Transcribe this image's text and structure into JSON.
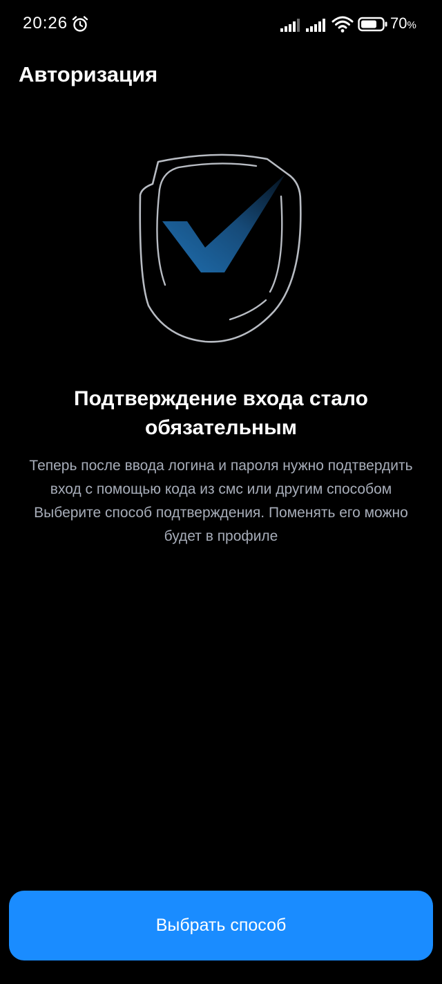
{
  "status_bar": {
    "time": "20:26",
    "battery_value": "70",
    "battery_unit": "%",
    "icons": [
      "alarm-icon",
      "signal-icon",
      "signal-icon",
      "wifi-icon",
      "battery-icon"
    ]
  },
  "header": {
    "title": "Авторизация"
  },
  "illustration": {
    "icon": "shield-check-icon",
    "accent_color": "#1f6fb0"
  },
  "content": {
    "headline": "Подтверждение входа стало обязательным",
    "description_1": "Теперь после ввода логина и пароля нужно подтвердить вход с помощью кода из смс или другим способом",
    "description_2": "Выберите способ подтверждения. Поменять его можно будет в профиле"
  },
  "actions": {
    "primary_label": "Выбрать способ",
    "primary_color": "#1a8cff"
  }
}
